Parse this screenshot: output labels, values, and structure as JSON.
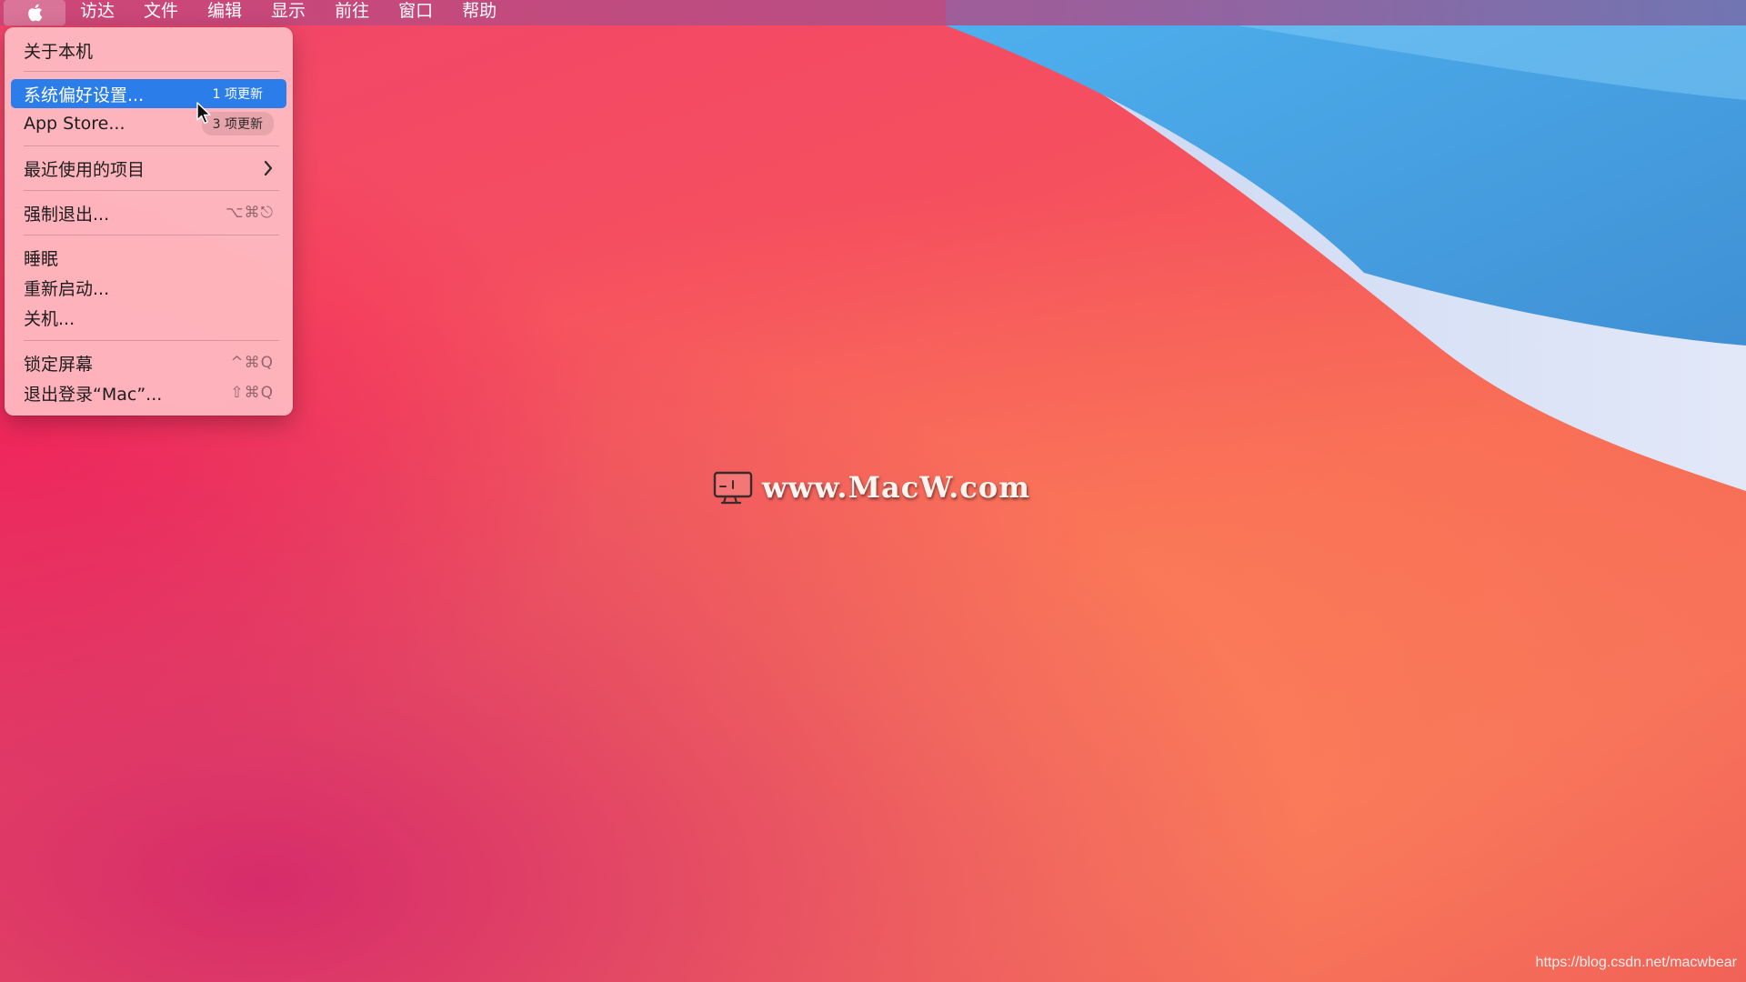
{
  "menubar": {
    "apple_icon": "apple-logo-icon",
    "items": [
      {
        "label": "访达"
      },
      {
        "label": "文件"
      },
      {
        "label": "编辑"
      },
      {
        "label": "显示"
      },
      {
        "label": "前往"
      },
      {
        "label": "窗口"
      },
      {
        "label": "帮助"
      }
    ]
  },
  "apple_menu": {
    "about": "关于本机",
    "system_prefs": {
      "label": "系统偏好设置...",
      "badge": "1 项更新"
    },
    "app_store": {
      "label": "App Store...",
      "badge": "3 项更新"
    },
    "recent_items": {
      "label": "最近使用的项目",
      "icon": "chevron-right-icon"
    },
    "force_quit": {
      "label": "强制退出...",
      "shortcut": "⌥⌘⎋"
    },
    "sleep": "睡眠",
    "restart": "重新启动...",
    "shutdown": "关机...",
    "lock_screen": {
      "label": "锁定屏幕",
      "shortcut": "^⌘Q"
    },
    "logout": {
      "label": "退出登录“Mac”...",
      "shortcut": "⇧⌘Q"
    }
  },
  "watermark": {
    "text": "www.MacW.com",
    "icon": "macw-logo-icon"
  },
  "footer_url": "https://blog.csdn.net/macwbear",
  "colors": {
    "highlight": "#2b7de9",
    "wallpaper_red": "#f5505e",
    "wallpaper_blue": "#5aafe6"
  }
}
